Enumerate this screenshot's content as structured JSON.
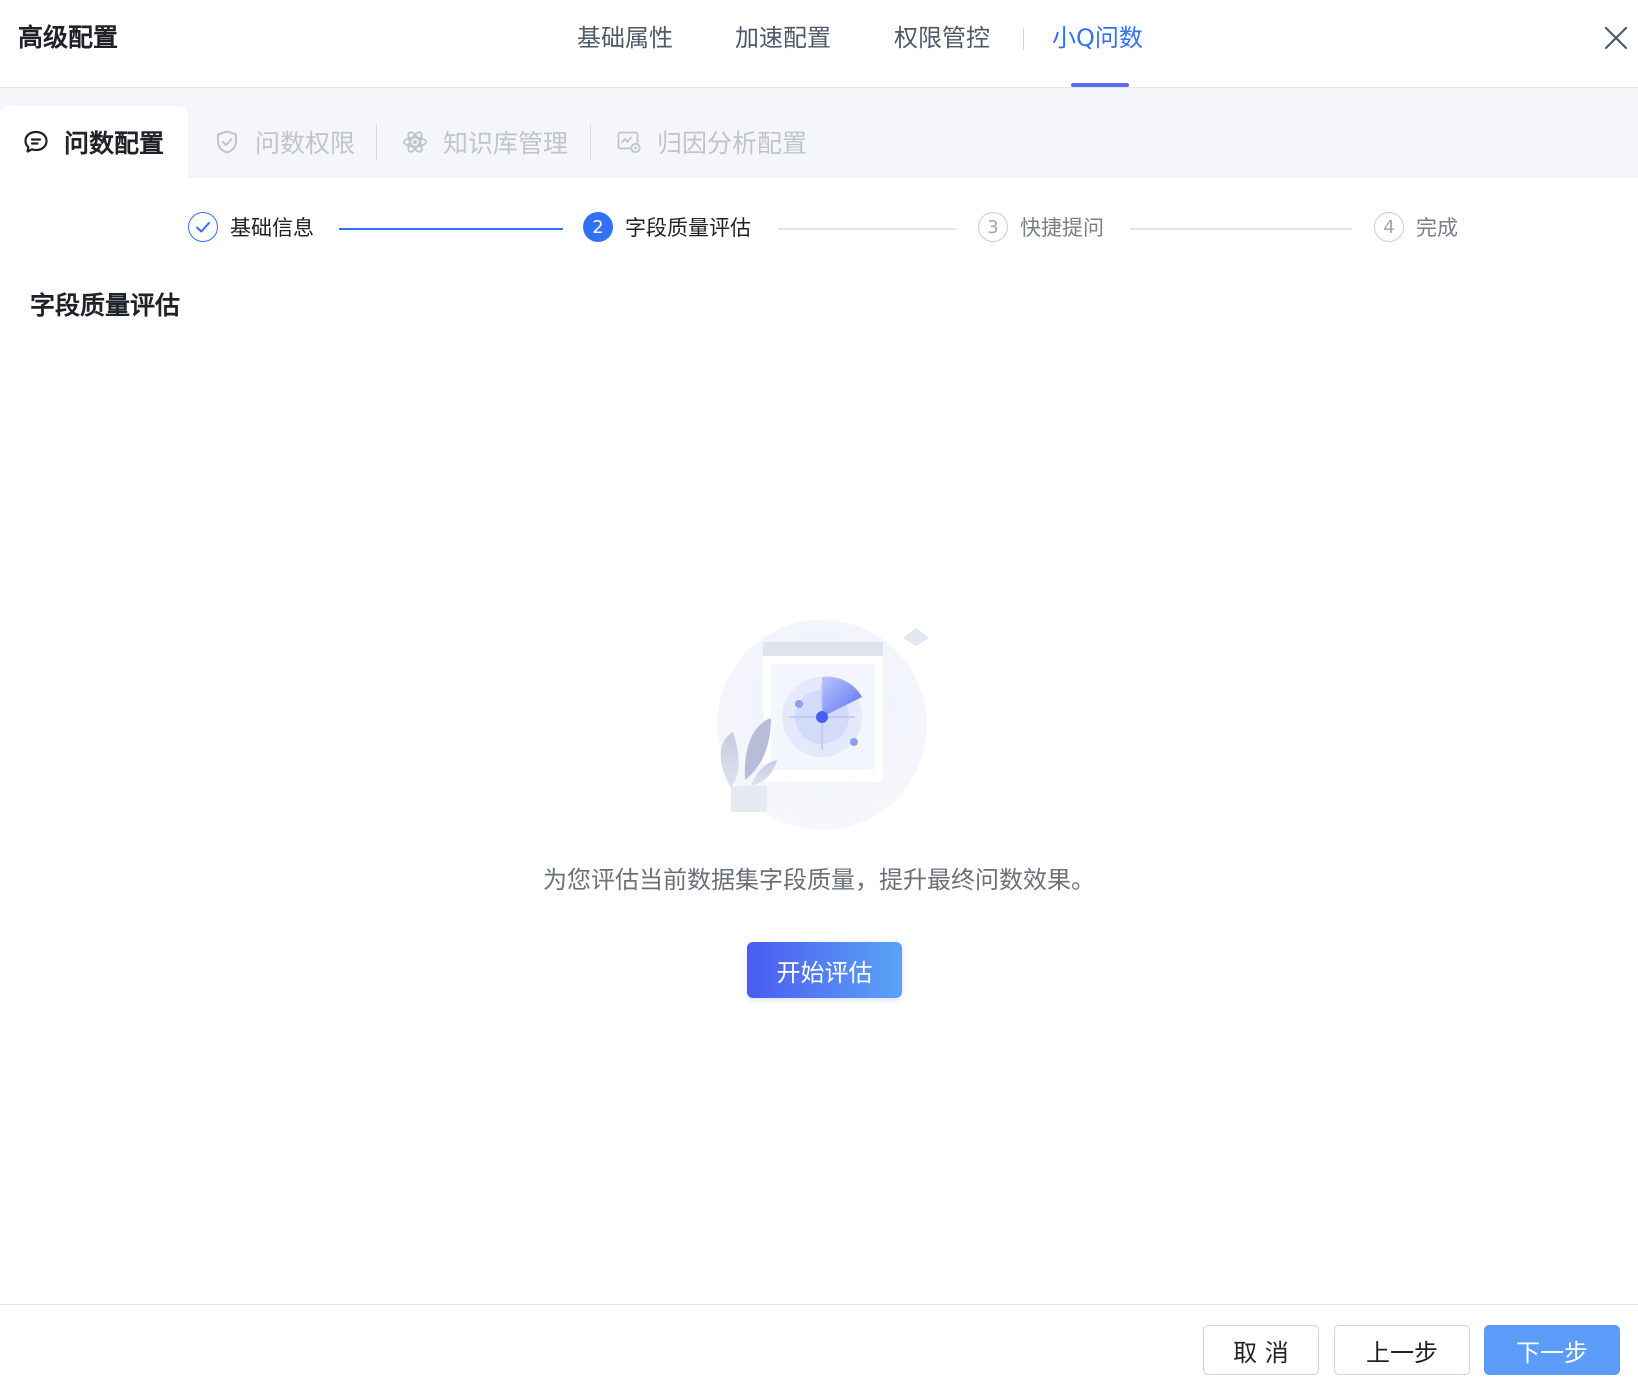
{
  "header": {
    "title": "高级配置",
    "tabs": [
      {
        "label": "基础属性"
      },
      {
        "label": "加速配置"
      },
      {
        "label": "权限管控"
      },
      {
        "label": "小Q问数"
      }
    ],
    "active_tab": "小Q问数",
    "close_icon": "close-icon"
  },
  "subtabs": [
    {
      "label": "问数配置",
      "icon": "chat-bubble-icon"
    },
    {
      "label": "问数权限",
      "icon": "shield-check-icon"
    },
    {
      "label": "知识库管理",
      "icon": "atom-icon"
    },
    {
      "label": "归因分析配置",
      "icon": "analysis-chart-icon"
    }
  ],
  "steps": [
    {
      "label": "基础信息",
      "status": "done"
    },
    {
      "number": "2",
      "label": "字段质量评估",
      "status": "current"
    },
    {
      "number": "3",
      "label": "快捷提问",
      "status": "todo"
    },
    {
      "number": "4",
      "label": "完成",
      "status": "todo"
    }
  ],
  "section": {
    "title": "字段质量评估"
  },
  "empty_state": {
    "illustration": "radar-scan-illustration",
    "description": "为您评估当前数据集字段质量，提升最终问数效果。",
    "button_label": "开始评估"
  },
  "footer": {
    "cancel_label": "取 消",
    "prev_label": "上一步",
    "next_label": "下一步"
  },
  "colors": {
    "accent": "#3271f6",
    "primary_button": "#5a9cf8",
    "gradient_start": "#4b5cf0",
    "gradient_end": "#5aa3f7"
  }
}
